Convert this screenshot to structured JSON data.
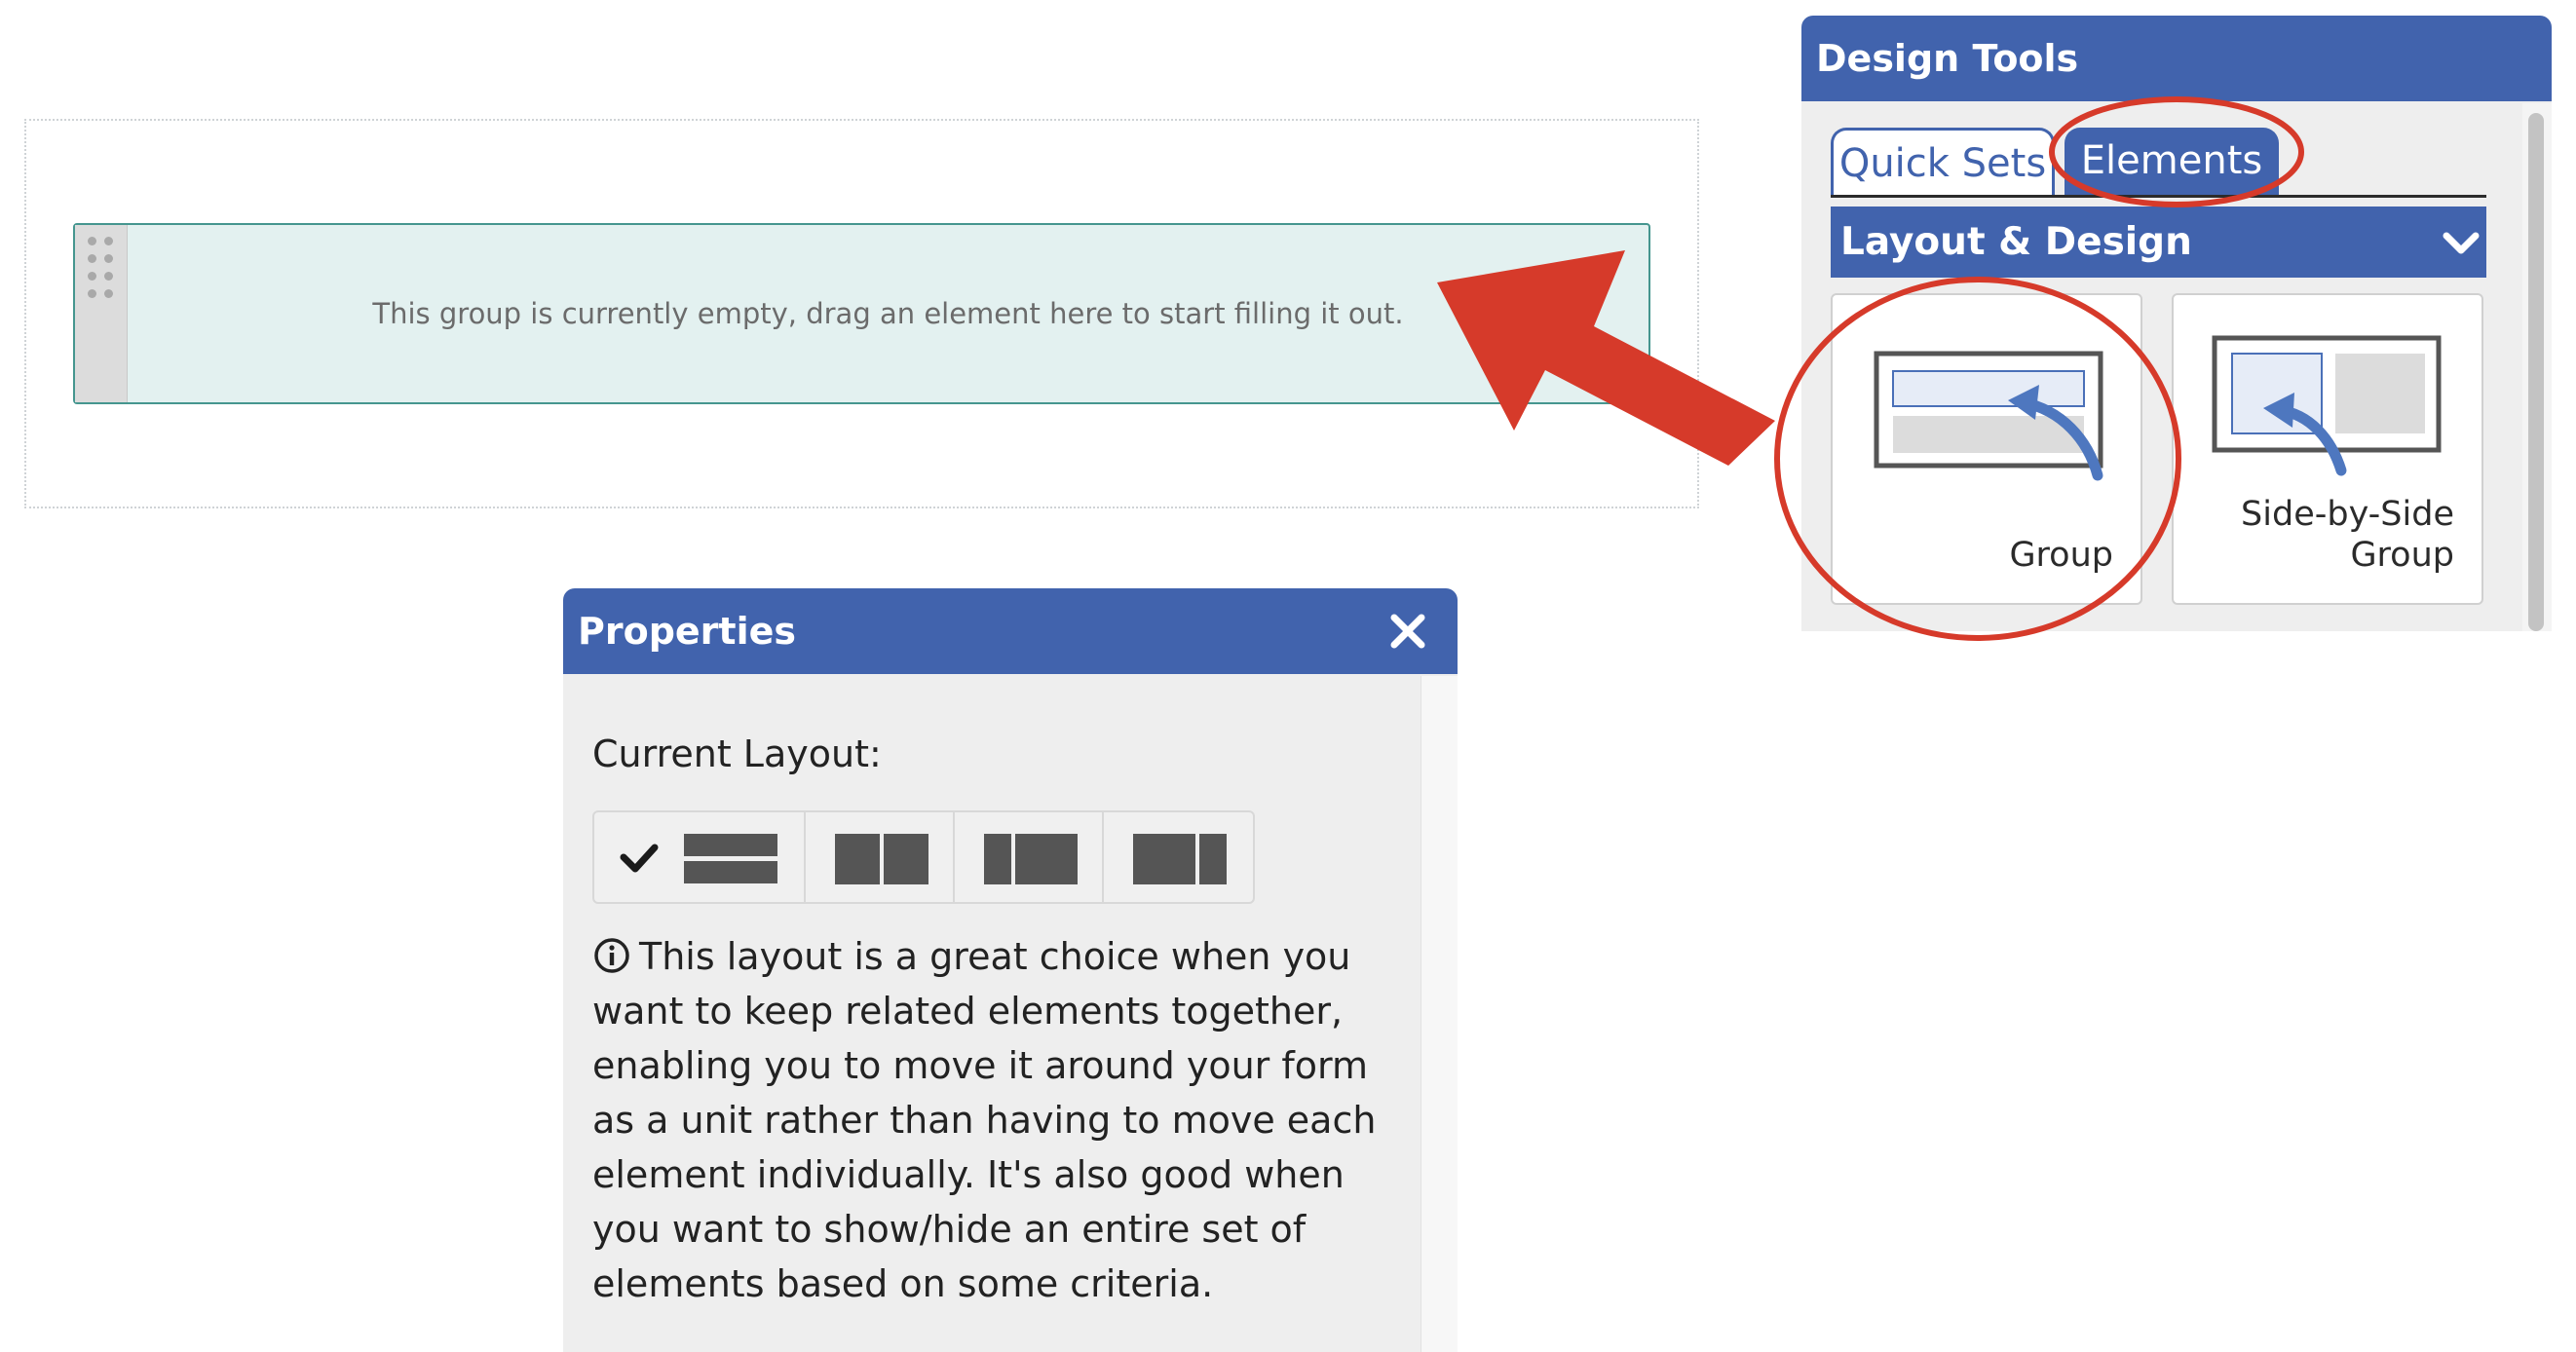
{
  "canvas": {
    "group_placeholder": "This group is currently empty, drag an element here to start filling it out."
  },
  "design_tools": {
    "title": "Design Tools",
    "tabs": [
      {
        "label": "Quick Sets"
      },
      {
        "label": "Elements",
        "active": true
      }
    ],
    "section_title": "Layout & Design",
    "tiles": [
      {
        "label": "Group",
        "icon": "group-layout-icon"
      },
      {
        "label_line1": "Side-by-Side",
        "label_line2": "Group",
        "icon": "side-by-side-layout-icon"
      }
    ]
  },
  "properties": {
    "title": "Properties",
    "current_layout_label": "Current Layout:",
    "layout_options": [
      {
        "icon": "stacked-layout-icon",
        "selected": true
      },
      {
        "icon": "two-column-equal-layout-icon"
      },
      {
        "icon": "two-column-wide-left-layout-icon"
      },
      {
        "icon": "two-column-wide-right-layout-icon"
      }
    ],
    "description": "This layout is a great choice when you want to keep related elements together, enabling you to move it around your form as a unit rather than having to move each element individually. It's also good when you want to show/hide an entire set of elements based on some criteria."
  },
  "colors": {
    "brand_blue": "#4163ad",
    "annotation_red": "#d63a2a",
    "group_fill": "#e3f1f0",
    "group_border": "#45968f"
  }
}
